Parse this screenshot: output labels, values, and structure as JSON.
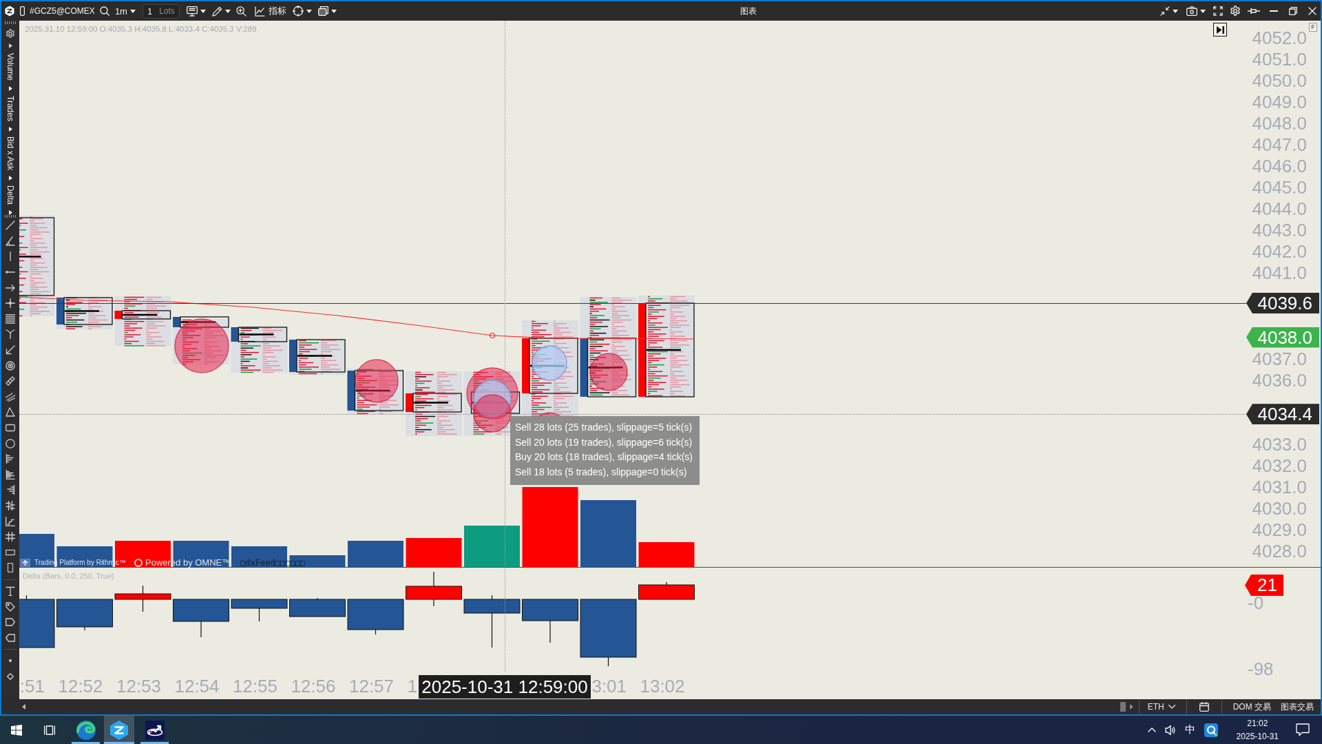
{
  "title_bar": {
    "symbol": "#GCZ5@COMEX",
    "timeframe": "1m",
    "quantity": {
      "value": "1",
      "unit": "Lots"
    },
    "indicators": "指标",
    "title": "图表"
  },
  "side_toolbar": {
    "sections": [
      {
        "label": "Volume"
      },
      {
        "label": "Trades"
      },
      {
        "label": "Bid x Ask"
      },
      {
        "label": "Delta"
      }
    ]
  },
  "chart": {
    "info": "2025.31.10 12:59:00 O:4035.3 H:4035.8 L:4033.4 C:4035.3 V:289",
    "corner_label": "F",
    "price_axis": {
      "upper": [
        "4052.0",
        "4051.0",
        "4050.0",
        "4049.0",
        "4048.0",
        "4047.0",
        "4046.0",
        "4045.0",
        "4044.0",
        "4043.0",
        "4042.0",
        "4041.0"
      ],
      "middle": [
        "4037.0",
        "4036.0"
      ],
      "lower": [
        "4033.0",
        "4032.0",
        "4031.0",
        "4030.0",
        "4029.0",
        "4028.0"
      ]
    },
    "price_badges": [
      {
        "text": "4039.6",
        "color": "#2b2b2b"
      },
      {
        "text": "4038.0",
        "color": "#3cb44b"
      },
      {
        "text": "4034.4",
        "color": "#2b2b2b"
      }
    ],
    "tooltip": [
      "Sell 28 lots (25 trades), slippage=5 tick(s)",
      "Sell 20 lots (19 trades), slippage=6 tick(s)",
      "Buy 20 lots (18 trades), slippage=4 tick(s)",
      "Sell 18 lots (5 trades), slippage=0 tick(s)"
    ],
    "attribution": [
      "Trading Platform by Rithmic™",
      "Powered by OMNE™",
      "□dxFeed□□□□□□"
    ]
  },
  "delta_pane": {
    "title": "Delta (Bars, 0.0, 250, True)",
    "axis": [
      "-0",
      "-98"
    ],
    "badge": {
      "text": "21",
      "color": "#ff0000"
    }
  },
  "time_axis": {
    "before": [
      ":51",
      "12:52",
      "12:53",
      "12:54",
      "12:55",
      "12:56",
      "12:57",
      "1"
    ],
    "crosshair": "2025-10-31 12:59:00",
    "after": [
      "3:01",
      "13:02"
    ]
  },
  "status_bar": {
    "session": "ETH",
    "buttons": [
      "DOM 交易",
      "图表交易"
    ]
  },
  "taskbar": {
    "apps": [
      {
        "kind": "swirl",
        "selected": false
      },
      {
        "kind": "hexagon",
        "selected": true
      },
      {
        "kind": "chart",
        "selected": false
      }
    ],
    "ime": "中",
    "time": "21:02",
    "date": "2025-10-31"
  }
}
